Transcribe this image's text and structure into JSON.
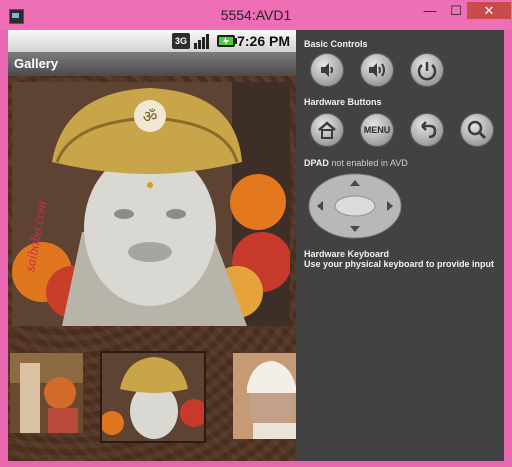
{
  "window": {
    "title": "5554:AVD1",
    "minimize_glyph": "—",
    "maximize_glyph": "☐",
    "close_glyph": "✕"
  },
  "statusbar": {
    "time": "7:26 PM",
    "network_label": "3G"
  },
  "app": {
    "title": "Gallery"
  },
  "main_photo": {
    "watermark": "saibaba.com"
  },
  "panel": {
    "basic_controls_title": "Basic Controls",
    "hardware_buttons_title": "Hardware Buttons",
    "dpad_title": "DPAD",
    "dpad_status": "not enabled in AVD",
    "menu_label": "MENU",
    "keyboard_title": "Hardware Keyboard",
    "keyboard_hint": "Use your physical keyboard to provide input"
  },
  "icons": {
    "volume_down": "volume-down-icon",
    "volume_up": "volume-up-icon",
    "power": "power-icon",
    "home": "home-icon",
    "back": "back-icon",
    "search": "search-icon"
  }
}
